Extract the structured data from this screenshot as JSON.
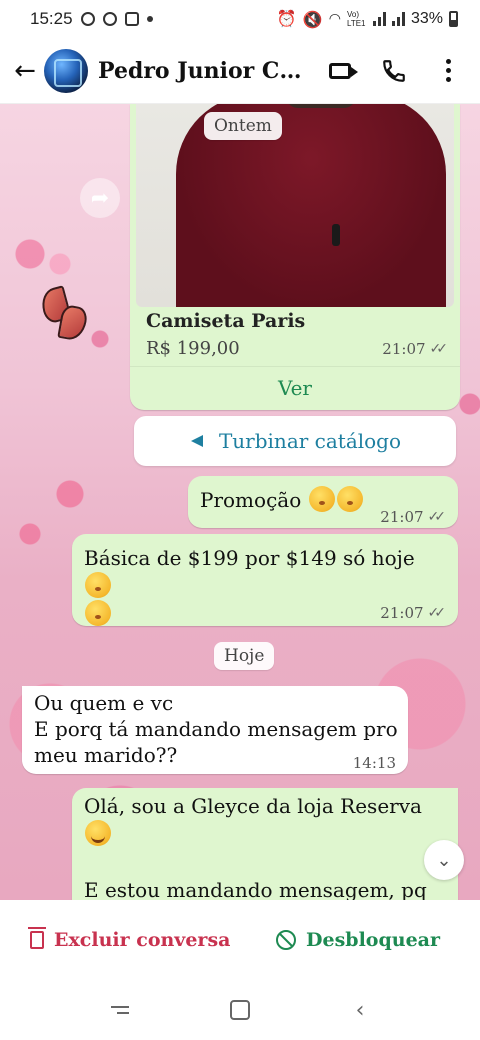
{
  "status_bar": {
    "time": "15:25",
    "battery": "33%",
    "network_label": "Vo) LTE1"
  },
  "header": {
    "contact_name": "Pedro Junior Client...",
    "icons": [
      "back-arrow-icon",
      "video-call-icon",
      "phone-call-icon",
      "more-options-icon"
    ]
  },
  "chat": {
    "date_yesterday": "Ontem",
    "date_today": "Hoje",
    "product": {
      "title": "Camiseta Paris",
      "price": "R$ 199,00",
      "time": "21:07",
      "ticks": "✓✓",
      "view_label": "Ver"
    },
    "boost_label": "Turbinar catálogo",
    "messages": [
      {
        "direction": "out",
        "text": "Promoção",
        "time": "21:07",
        "ticks": "✓✓"
      },
      {
        "direction": "out",
        "text": "Básica de $199 por $149 só hoje",
        "time": "21:07",
        "ticks": "✓✓"
      },
      {
        "direction": "in",
        "lines": [
          "Ou quem e vc",
          "E porq tá mandando mensagem pro",
          "meu marido??"
        ],
        "time": "14:13"
      },
      {
        "direction": "out",
        "lines": [
          "Olá,  sou a Gleyce da loja Reserva",
          "E estou mandando mensagem, pq da"
        ]
      }
    ]
  },
  "actions": {
    "delete_label": "Excluir conversa",
    "unblock_label": "Desbloquear"
  },
  "colors": {
    "outgoing_bubble": "#dff6cf",
    "incoming_bubble": "#ffffff",
    "accent_green": "#1e8a52",
    "danger_red": "#c8324f",
    "link_blue": "#1e7fa0"
  }
}
